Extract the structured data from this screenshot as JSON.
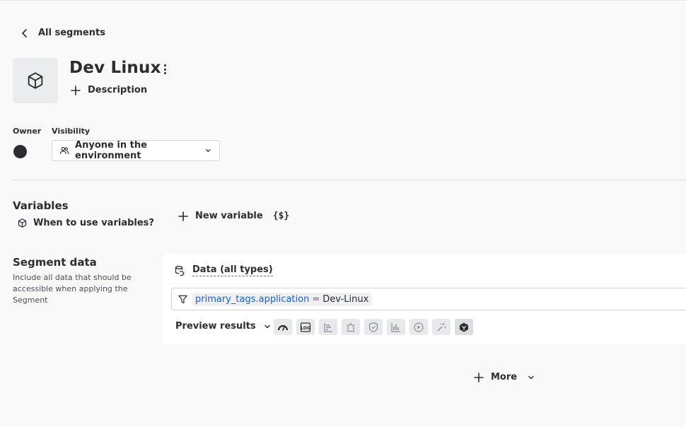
{
  "nav": {
    "back_label": "All segments"
  },
  "segment": {
    "title": "Dev Linux",
    "description_label": "Description"
  },
  "owner": {
    "label": "Owner"
  },
  "visibility": {
    "label": "Visibility",
    "value": "Anyone in the environment"
  },
  "variables": {
    "title": "Variables",
    "help_link": "When to use variables?",
    "new_variable_label": "New variable",
    "new_variable_symbol": "{$}"
  },
  "segment_data": {
    "title": "Segment data",
    "help_text": "Include all data that should be accessible when applying the Segment",
    "data_source": "Data (all types)",
    "filter": {
      "key": "primary_tags.application",
      "operator": "=",
      "value": "Dev-Linux"
    },
    "preview_label": "Preview results",
    "preview_icons": [
      "gauge-icon",
      "log-icon",
      "bar-list-icon",
      "alert-siren-icon",
      "shield-icon",
      "chart-bars-icon",
      "play-circle-icon",
      "sparkle-icon",
      "cube-dark-icon"
    ]
  },
  "footer": {
    "more_label": "More"
  },
  "colors": {
    "accent_key": "#1d5fcf",
    "operator": "#9a3dc7",
    "text": "#2b2d33"
  }
}
